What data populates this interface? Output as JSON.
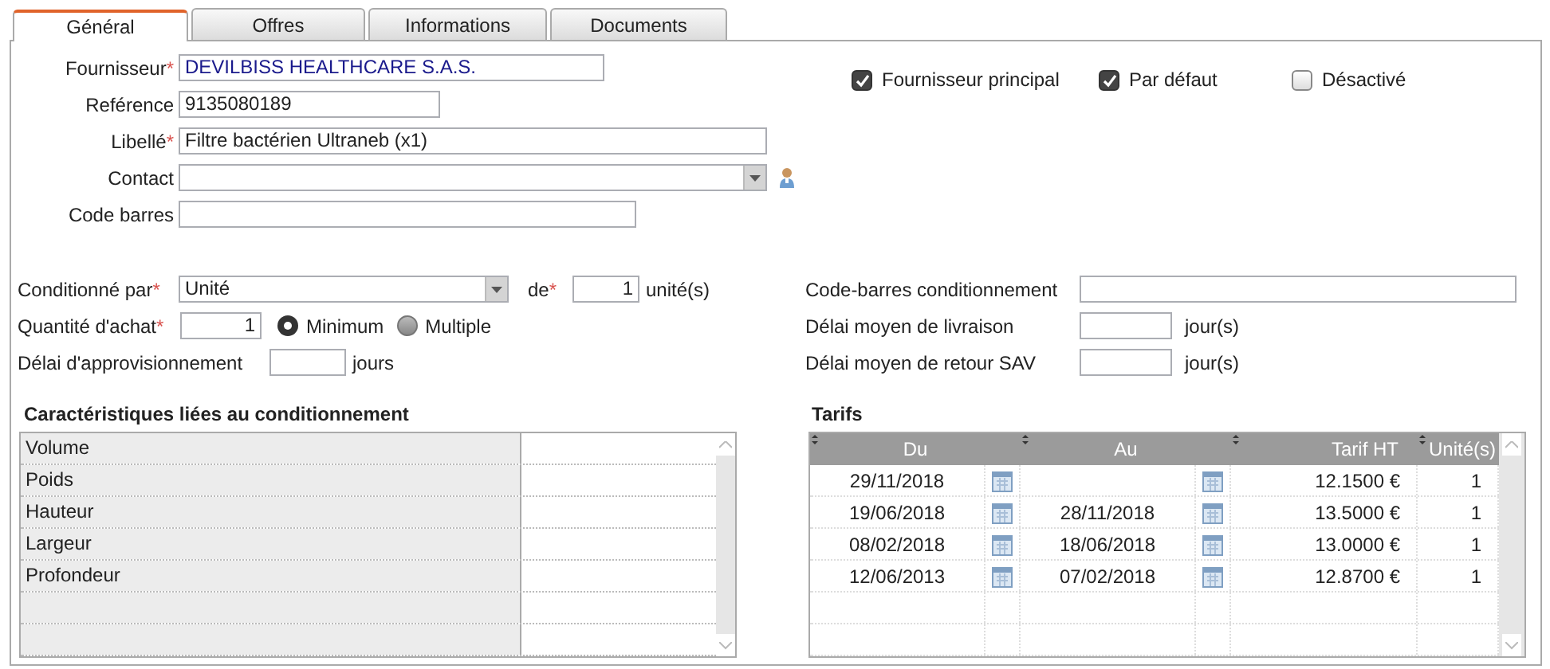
{
  "tabs": [
    {
      "label": "Général",
      "selected": true
    },
    {
      "label": "Offres",
      "selected": false
    },
    {
      "label": "Informations",
      "selected": false
    },
    {
      "label": "Documents",
      "selected": false
    }
  ],
  "supplier": {
    "fields": [
      {
        "label": "Fournisseur",
        "required_mark": "*",
        "value": "DEVILBISS HEALTHCARE S.A.S.",
        "kind": "lookup"
      },
      {
        "label": "Reférence",
        "value": "9135080189",
        "kind": "text"
      },
      {
        "label": "Libellé",
        "required_mark": "*",
        "value": "Filtre bactérien Ultraneb (x1)",
        "kind": "text"
      },
      {
        "label": "Contact",
        "kind": "select"
      },
      {
        "label": "Code barres",
        "kind": "text"
      }
    ],
    "options": [
      {
        "label": "Fournisseur principal",
        "checked": true
      },
      {
        "label": "Par défaut",
        "checked": true
      },
      {
        "label": "Désactivé",
        "checked": false
      }
    ]
  },
  "packaging": {
    "conditioned_by": {
      "label": "Conditionné par",
      "required_mark": "*",
      "value": "Unité"
    },
    "count": {
      "label": "de",
      "required_mark": "*",
      "value": "1",
      "unit": "unité(s)"
    },
    "purchase_qty": {
      "label": "Quantité d'achat",
      "required_mark": "*",
      "value": "1",
      "modes": [
        {
          "label": "Minimum",
          "selected": true
        },
        {
          "label": "Multiple",
          "selected": false
        }
      ]
    },
    "lead_time": {
      "label": "Délai d'approvisionnement",
      "unit": "jours"
    },
    "barcode": {
      "label": "Code-barres conditionnement"
    },
    "delivery_delay": {
      "label": "Délai moyen de livraison",
      "unit": "jour(s)"
    },
    "return_delay": {
      "label": "Délai moyen de retour SAV",
      "unit": "jour(s)"
    }
  },
  "characteristics": {
    "title": "Caractéristiques liées au conditionnement",
    "rows": [
      "Volume",
      "Poids",
      "Hauteur",
      "Largeur",
      "Profondeur"
    ]
  },
  "tarifs": {
    "title": "Tarifs",
    "columns": [
      "Du",
      "Au",
      "Tarif HT",
      "Unité(s)"
    ],
    "rows": [
      {
        "from": "29/11/2018",
        "price": "12.1500 €",
        "units": "1"
      },
      {
        "from": "19/06/2018",
        "to": "28/11/2018",
        "price": "13.5000 €",
        "units": "1"
      },
      {
        "from": "08/02/2018",
        "to": "18/06/2018",
        "price": "13.0000 €",
        "units": "1"
      },
      {
        "from": "12/06/2013",
        "to": "07/02/2018",
        "price": "12.8700 €",
        "units": "1"
      }
    ]
  }
}
